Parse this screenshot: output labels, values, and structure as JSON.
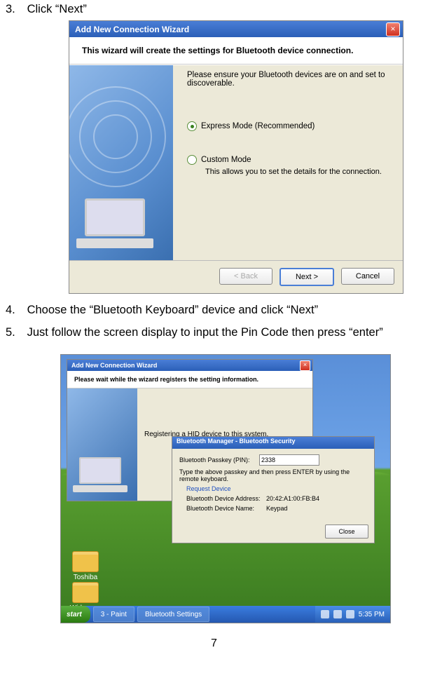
{
  "steps": {
    "s3": {
      "num": "3.",
      "text": "Click “Next”"
    },
    "s4": {
      "num": "4.",
      "text": "Choose the “Bluetooth Keyboard” device and click “Next”"
    },
    "s5": {
      "num": "5.",
      "text": "Just follow the screen display to input the Pin Code then press “enter”"
    }
  },
  "wizard1": {
    "title": "Add New Connection Wizard",
    "banner": "This wizard will create the settings for Bluetooth device connection.",
    "instruction": "Please ensure your Bluetooth devices are on and set to discoverable.",
    "opt_express": "Express Mode (Recommended)",
    "opt_custom": "Custom Mode",
    "custom_hint": "This allows you to set the details for the connection.",
    "btn_back": "< Back",
    "btn_next": "Next >",
    "btn_cancel": "Cancel"
  },
  "shot2": {
    "folder1": "Toshiba",
    "folder2": "Widcomm",
    "wiz_title": "Add New Connection Wizard",
    "wiz_banner": "Please wait while the wizard registers the setting information.",
    "reg_msg": "Registering a HID device to this system.",
    "sec_title": "Bluetooth Manager - Bluetooth Security",
    "passkey_label": "Bluetooth Passkey (PIN):",
    "passkey_value": "2338",
    "hint": "Type the above passkey and then press ENTER by using the remote keyboard.",
    "request": "Request Device",
    "addr_label": "Bluetooth Device Address:",
    "addr_value": "20:42:A1:00:FB:B4",
    "name_label": "Bluetooth Device Name:",
    "name_value": "Keypad",
    "btn_close": "Close",
    "start": "start",
    "task1": "3 - Paint",
    "task2": "Bluetooth Settings",
    "clock": "5:35 PM"
  },
  "page": "7"
}
